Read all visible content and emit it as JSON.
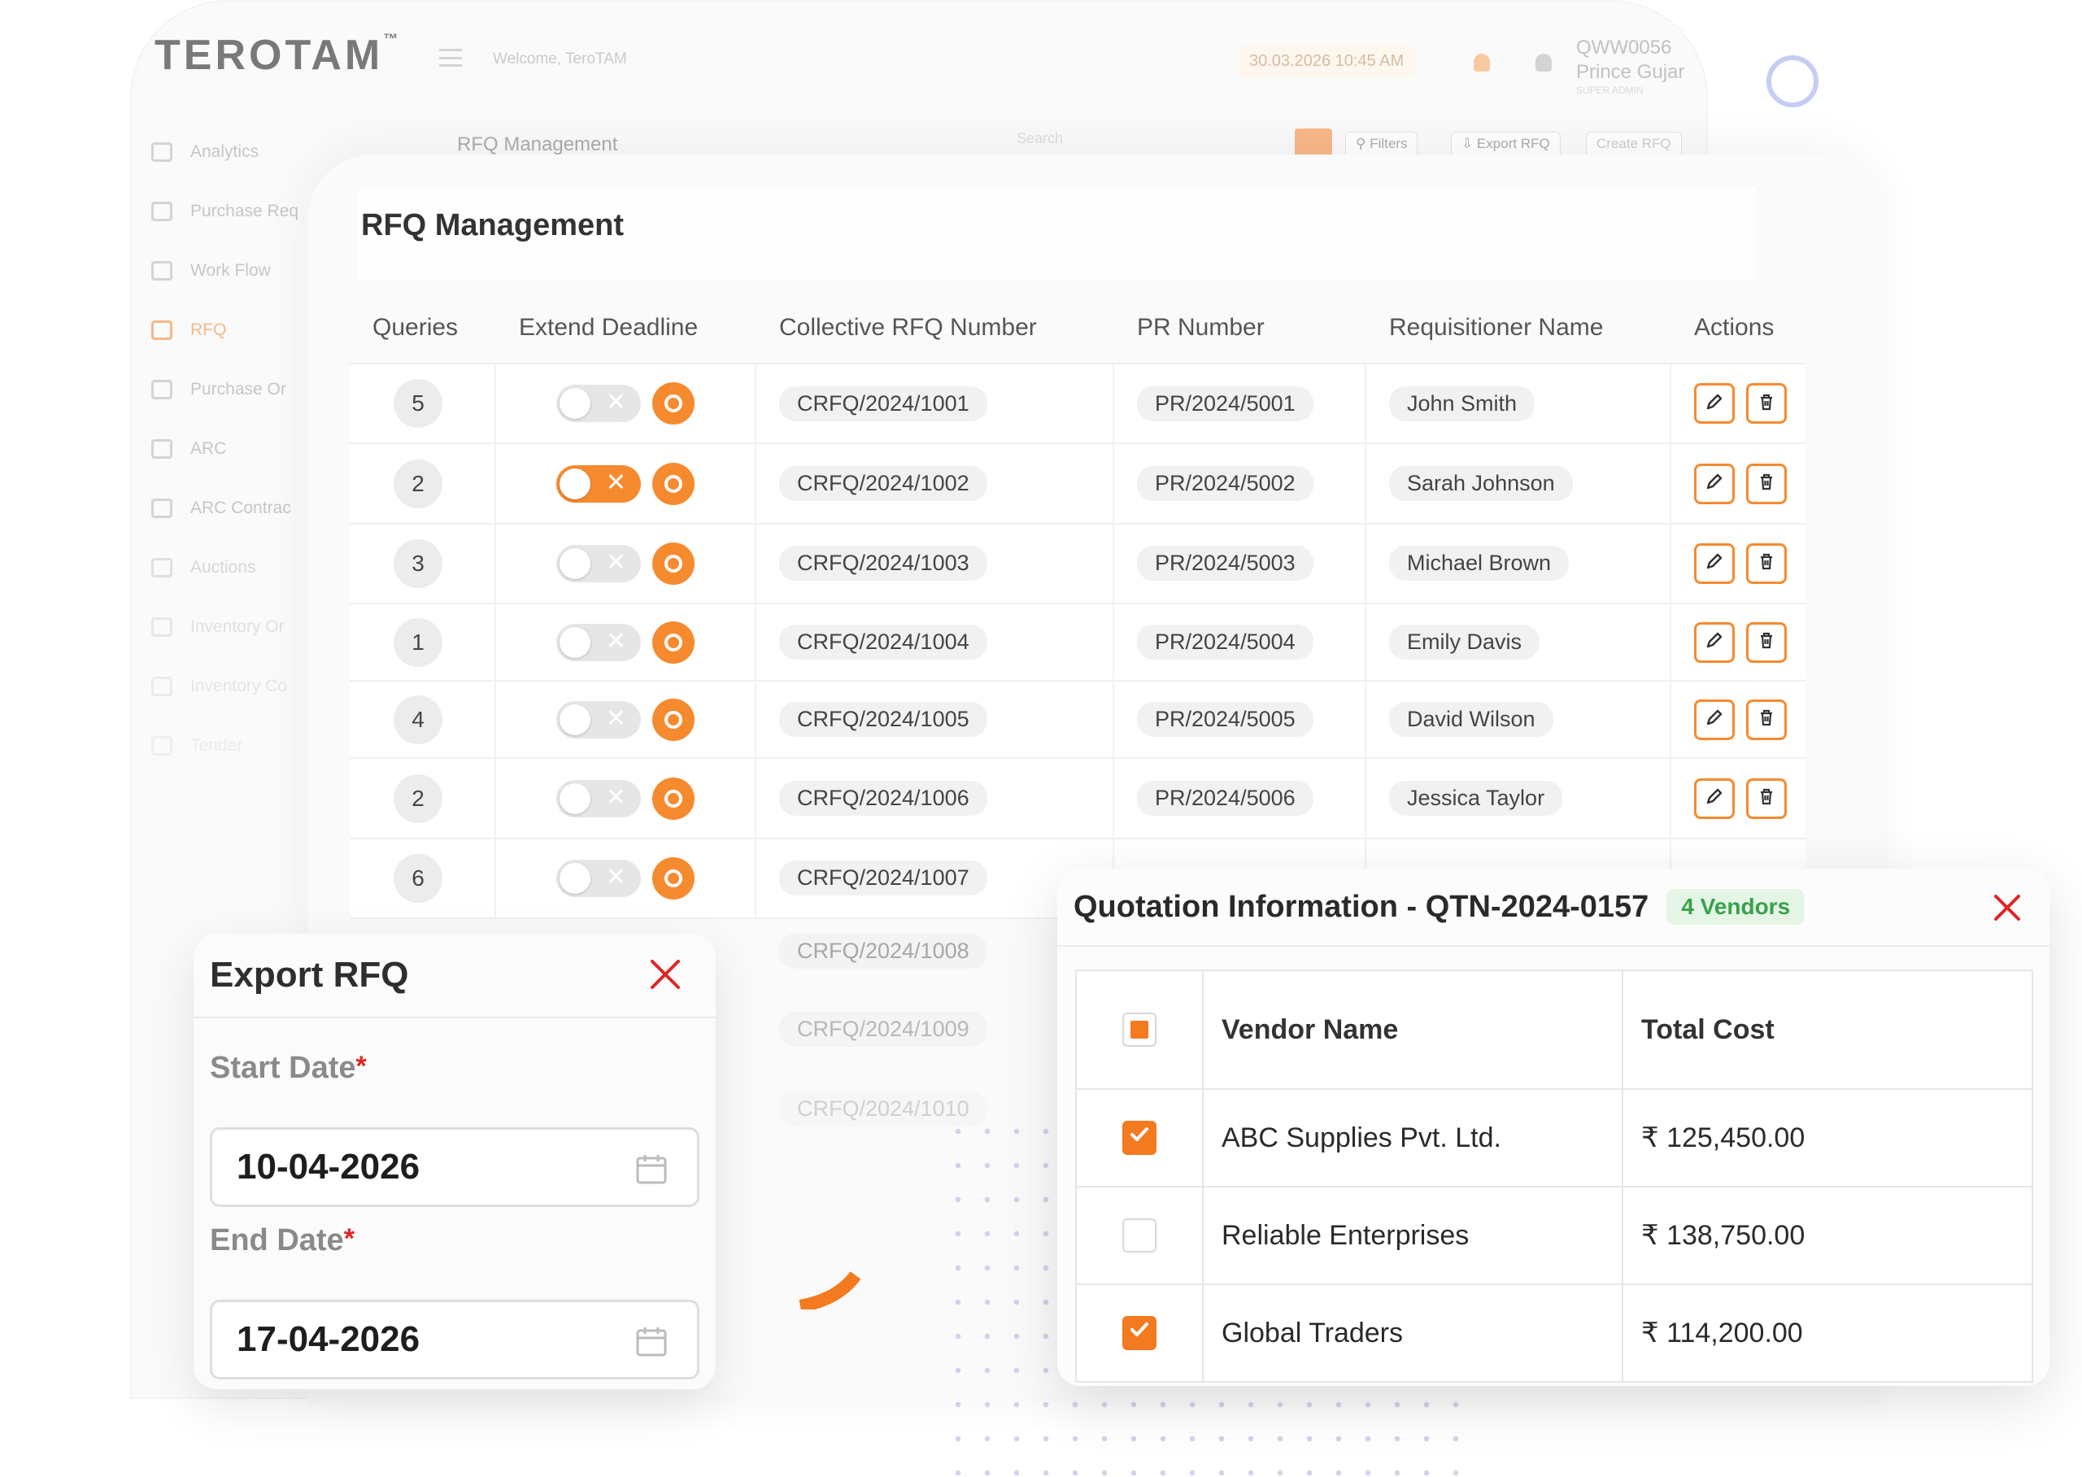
{
  "app": {
    "logo": "TEROTAM",
    "trademark": "™",
    "welcome": "Welcome, TeroTAM",
    "datetime": "30.03.2026 10:45 AM",
    "user_id": "QWW0056",
    "user_name": "Prince Gujar",
    "user_role": "SUPER ADMIN"
  },
  "sidebar": {
    "items": [
      {
        "label": "Analytics"
      },
      {
        "label": "Purchase Req"
      },
      {
        "label": "Work Flow"
      },
      {
        "label": "RFQ"
      },
      {
        "label": "Purchase Or"
      },
      {
        "label": "ARC"
      },
      {
        "label": "ARC Contrac"
      },
      {
        "label": "Auctions"
      },
      {
        "label": "Inventory Or"
      },
      {
        "label": "Inventory Co"
      },
      {
        "label": "Tender"
      }
    ]
  },
  "toolbar": {
    "title": "RFQ Management",
    "search_placeholder": "Search",
    "filters": "Filters",
    "export": "Export RFQ",
    "create": "Create RFQ"
  },
  "main": {
    "title": "RFQ Management",
    "columns": [
      "Queries",
      "Extend Deadline",
      "Collective RFQ Number",
      "PR Number",
      "Requisitioner Name",
      "Actions"
    ],
    "rows": [
      {
        "queries": "5",
        "extend": false,
        "crfq": "CRFQ/2024/1001",
        "pr": "PR/2024/5001",
        "name": "John Smith"
      },
      {
        "queries": "2",
        "extend": true,
        "crfq": "CRFQ/2024/1002",
        "pr": "PR/2024/5002",
        "name": "Sarah Johnson"
      },
      {
        "queries": "3",
        "extend": false,
        "crfq": "CRFQ/2024/1003",
        "pr": "PR/2024/5003",
        "name": "Michael Brown"
      },
      {
        "queries": "1",
        "extend": false,
        "crfq": "CRFQ/2024/1004",
        "pr": "PR/2024/5004",
        "name": "Emily Davis"
      },
      {
        "queries": "4",
        "extend": false,
        "crfq": "CRFQ/2024/1005",
        "pr": "PR/2024/5005",
        "name": "David Wilson"
      },
      {
        "queries": "2",
        "extend": false,
        "crfq": "CRFQ/2024/1006",
        "pr": "PR/2024/5006",
        "name": "Jessica Taylor"
      },
      {
        "queries": "6",
        "extend": false,
        "crfq": "CRFQ/2024/1007",
        "pr": "",
        "name": ""
      }
    ],
    "faded_rows": [
      "CRFQ/2024/1008",
      "CRFQ/2024/1009",
      "CRFQ/2024/1010"
    ],
    "toggle_off_glyph": "✕"
  },
  "export_modal": {
    "title": "Export RFQ",
    "start_label": "Start Date",
    "start_value": "10-04-2026",
    "end_label": "End Date",
    "end_value": "17-04-2026",
    "required_mark": "*"
  },
  "quotation_modal": {
    "title": "Quotation Information - QTN-2024-0157",
    "badge": "4 Vendors",
    "col_vendor": "Vendor Name",
    "col_cost": "Total Cost",
    "vendors": [
      {
        "name": "ABC Supplies Pvt. Ltd.",
        "cost": "₹ 125,450.00",
        "checked": true
      },
      {
        "name": "Reliable Enterprises",
        "cost": "₹ 138,750.00",
        "checked": false
      },
      {
        "name": "Global Traders",
        "cost": "₹ 114,200.00",
        "checked": true
      }
    ]
  },
  "colors": {
    "accent": "#f68a2f",
    "close_red": "#e02424",
    "badge_green": "#3aa14a"
  }
}
